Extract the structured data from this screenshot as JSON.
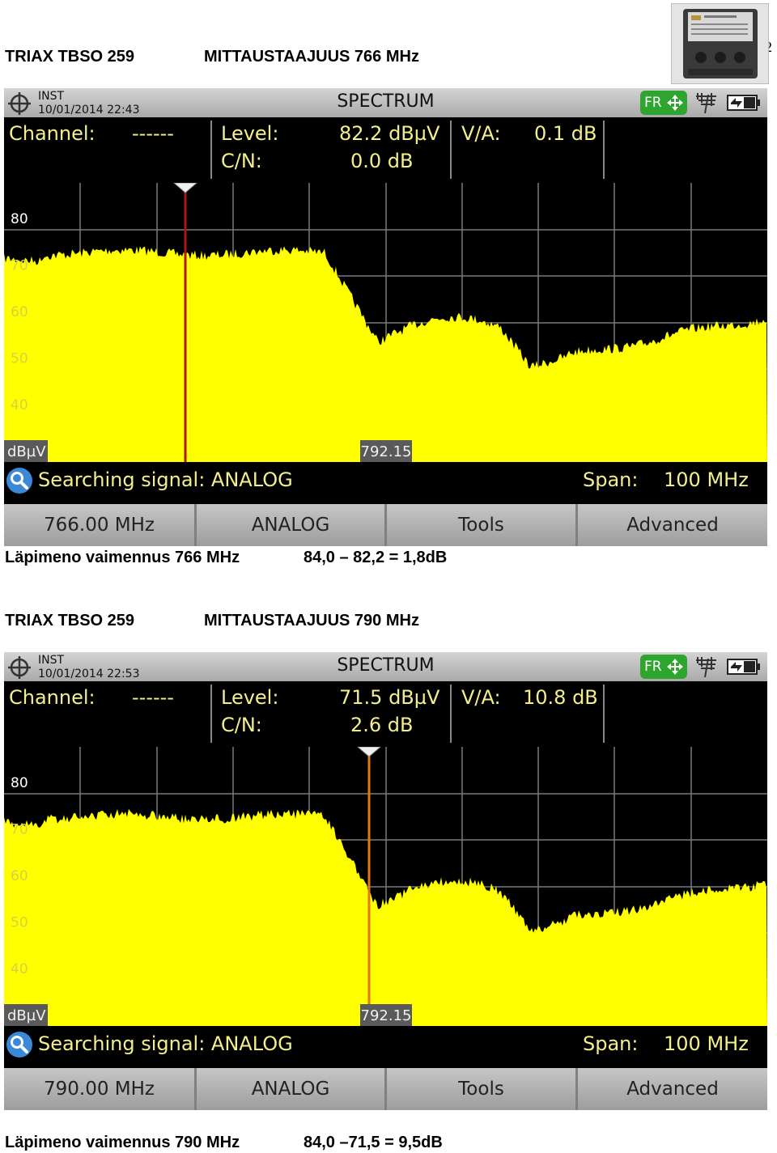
{
  "page_number": "2",
  "sections": [
    {
      "title_left": "TRIAX TBSO 259",
      "title_right": "MITTAUSTAAJUUS 766 MHz",
      "screen": {
        "mode": "INST",
        "datetime": "10/01/2014 22:43",
        "title": "SPECTRUM",
        "fr_label": "FR",
        "channel_label": "Channel:",
        "channel_value": "------",
        "level_label": "Level:",
        "level_value": "82.2 dBµV",
        "cn_label": "C/N:",
        "cn_value": "0.0 dB",
        "va_label": "V/A:",
        "va_value": "0.1 dB",
        "y_ticks": [
          "80",
          "70",
          "60",
          "50",
          "40"
        ],
        "unit_label": "dBµV",
        "center_freq_label": "792.15",
        "marker_fraction": 0.238,
        "marker_color": "#b01515",
        "status_text": "Searching signal: ANALOG",
        "span_label": "Span:",
        "span_value": "100 MHz",
        "softkeys": [
          "766.00 MHz",
          "ANALOG",
          "Tools",
          "Advanced"
        ]
      },
      "caption_left": "Läpimeno vaimennus 766 MHz",
      "caption_right": "84,0 – 82,2 = 1,8dB"
    },
    {
      "title_left": "TRIAX TBSO 259",
      "title_right": "MITTAUSTAAJUUS 790 MHz",
      "screen": {
        "mode": "INST",
        "datetime": "10/01/2014 22:53",
        "title": "SPECTRUM",
        "fr_label": "FR",
        "channel_label": "Channel:",
        "channel_value": "------",
        "level_label": "Level:",
        "level_value": "71.5 dBµV",
        "cn_label": "C/N:",
        "cn_value": "2.6 dB",
        "va_label": "V/A:",
        "va_value": "10.8 dB",
        "y_ticks": [
          "80",
          "70",
          "60",
          "50",
          "40"
        ],
        "unit_label": "dBµV",
        "center_freq_label": "792.15",
        "marker_fraction": 0.478,
        "marker_color": "#e07a10",
        "status_text": "Searching signal: ANALOG",
        "span_label": "Span:",
        "span_value": "100 MHz",
        "softkeys": [
          "790.00 MHz",
          "ANALOG",
          "Tools",
          "Advanced"
        ]
      },
      "caption_left": "Läpimeno vaimennus 790 MHz",
      "caption_right": "84,0 –71,5 = 9,5dB"
    }
  ],
  "colors": {
    "trace": "#ffff00",
    "readout_text": "#f4ef8a",
    "grid": "#7a7a7a",
    "fr_badge": "#2ea52e"
  }
}
